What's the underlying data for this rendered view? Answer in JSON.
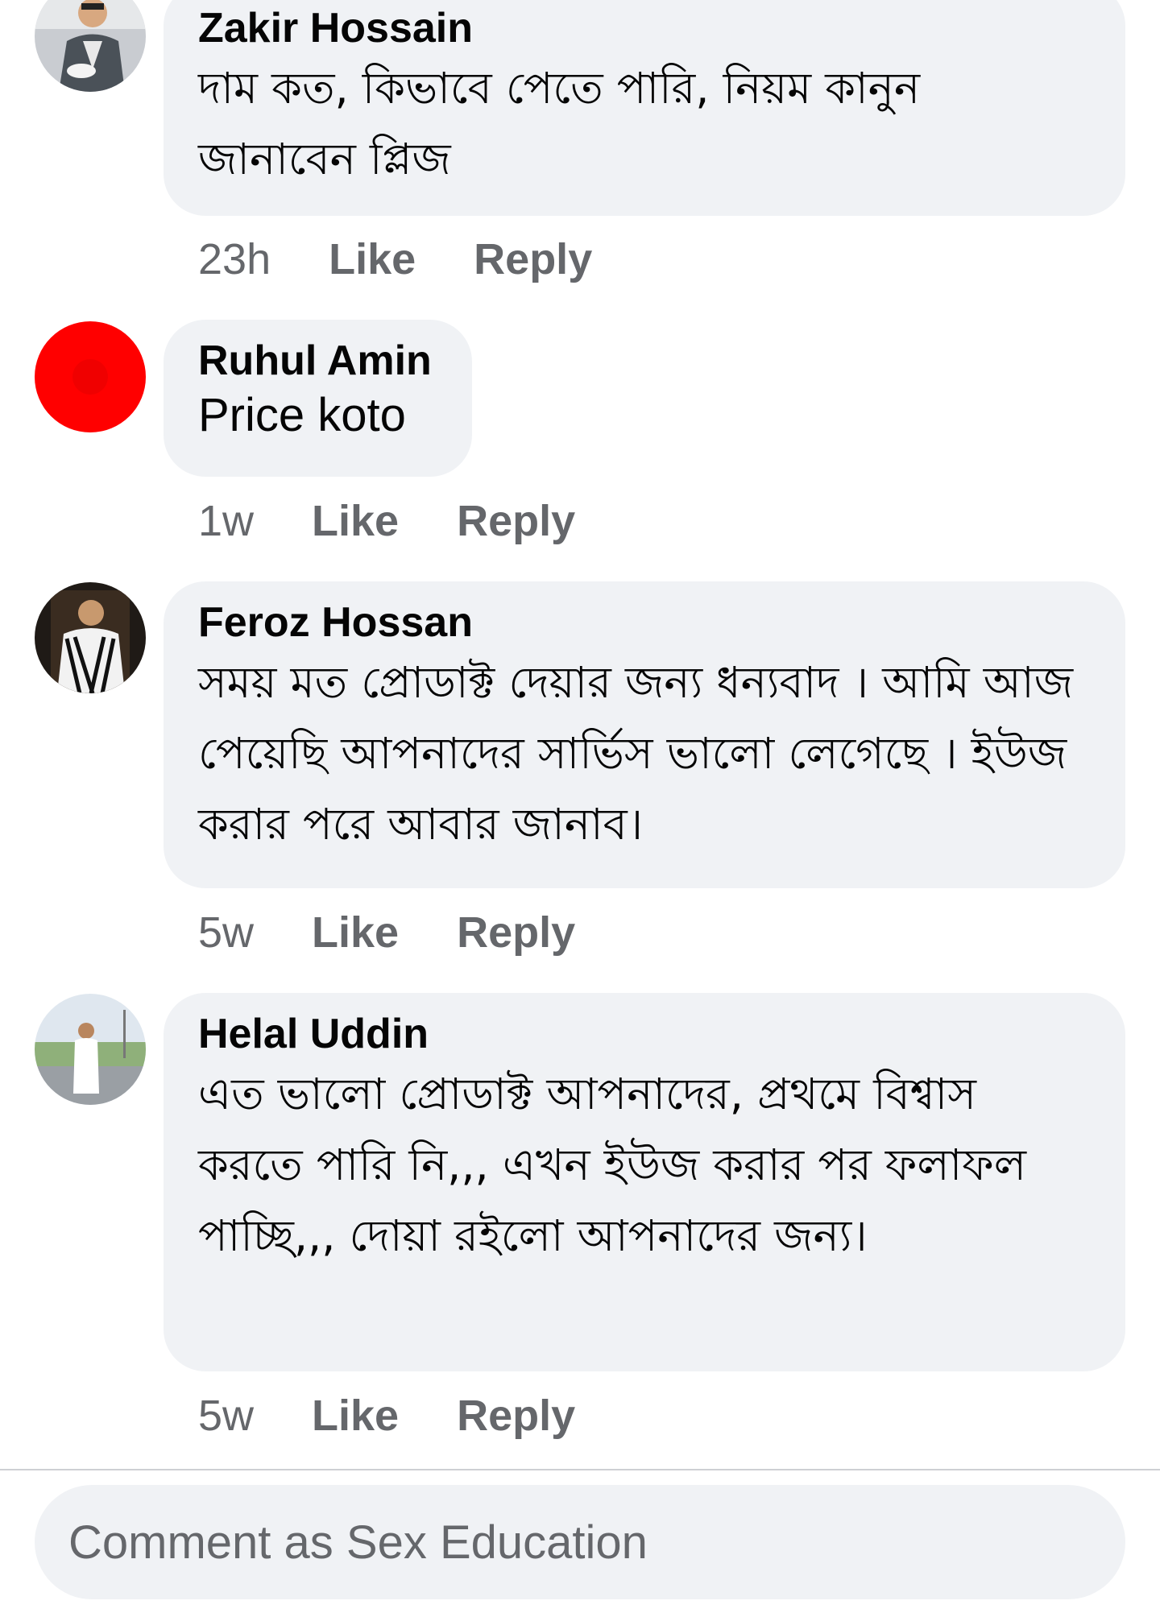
{
  "comments": [
    {
      "author": "Zakir Hossain",
      "text": "দাম কত, কিভাবে পেতে পারি, নিয়ম কানুন জানাবেন প্লিজ",
      "time": "23h",
      "like_label": "Like",
      "reply_label": "Reply",
      "avatar_icon": "profile-photo-man-in-suit"
    },
    {
      "author": "Ruhul Amin",
      "text": "Price koto",
      "time": "1w",
      "like_label": "Like",
      "reply_label": "Reply",
      "avatar_icon": "profile-photo-red-circle"
    },
    {
      "author": "Feroz Hossan",
      "text": "সময় মত প্রোডাক্ট দেয়ার জন্য ধন্যবাদ । আমি আজ পেয়েছি আপনাদের সার্ভিস ভালো লেগেছে । ইউজ করার পরে আবার জানাব।",
      "time": "5w",
      "like_label": "Like",
      "reply_label": "Reply",
      "avatar_icon": "profile-photo-man-in-patterned-jacket"
    },
    {
      "author": "Helal Uddin",
      "text": "এত ভালো প্রোডাক্ট আপনাদের, প্রথমে বিশ্বাস করতে পারি নি,,, এখন ইউজ করার পর ফলাফল পাচ্ছি,,, দোয়া রইলো আপনাদের জন্য।",
      "time": "5w",
      "like_label": "Like",
      "reply_label": "Reply",
      "avatar_icon": "profile-photo-man-in-white-outdoors"
    }
  ],
  "composer": {
    "placeholder": "Comment as Sex Education"
  },
  "colors": {
    "bubble_bg": "#f0f2f5",
    "secondary_text": "#65676b",
    "primary_text": "#050505",
    "divider": "#ced0d4"
  }
}
